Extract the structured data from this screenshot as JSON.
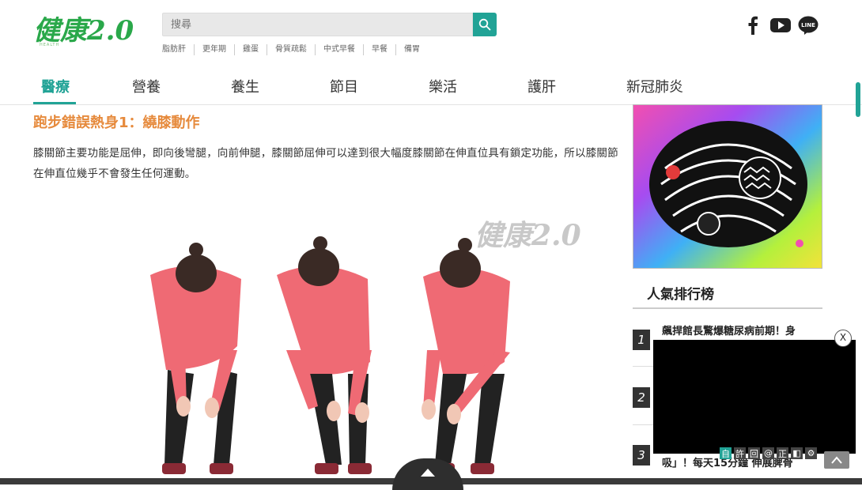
{
  "header": {
    "logo_text": "健康2.0",
    "search_placeholder": "搜尋",
    "tags": [
      "脂肪肝",
      "更年期",
      "雞蛋",
      "骨質疏鬆",
      "中式早餐",
      "早餐",
      "備胃"
    ]
  },
  "nav": {
    "items": [
      "醫療",
      "營養",
      "養生",
      "節目",
      "樂活",
      "護肝",
      "新冠肺炎"
    ],
    "active": "醫療"
  },
  "article": {
    "heading": "跑步錯誤熱身1：繞膝動作",
    "paragraph": "膝關節主要功能是屈伸，即向後彎腿，向前伸腿，膝關節屈伸可以達到很大幅度膝關節在伸直位具有鎖定功能，所以膝關節在伸直位幾乎不會發生任何運動。",
    "watermark": "健康2.0"
  },
  "sidebar": {
    "ranking_title": "人氣排行榜",
    "ranking": [
      {
        "num": "1",
        "text": "飆捍館長驚爆糖尿病前期！身"
      },
      {
        "num": "2",
        "text": ""
      },
      {
        "num": "3",
        "text": "吸」！每天15分鐘 伸展脾骨"
      }
    ]
  },
  "video": {
    "close_label": "X",
    "tools": [
      "自",
      "許",
      "回",
      "@",
      "正",
      "◧",
      "⚙"
    ]
  },
  "colors": {
    "accent": "#21a396",
    "heading": "#e68a3c"
  }
}
